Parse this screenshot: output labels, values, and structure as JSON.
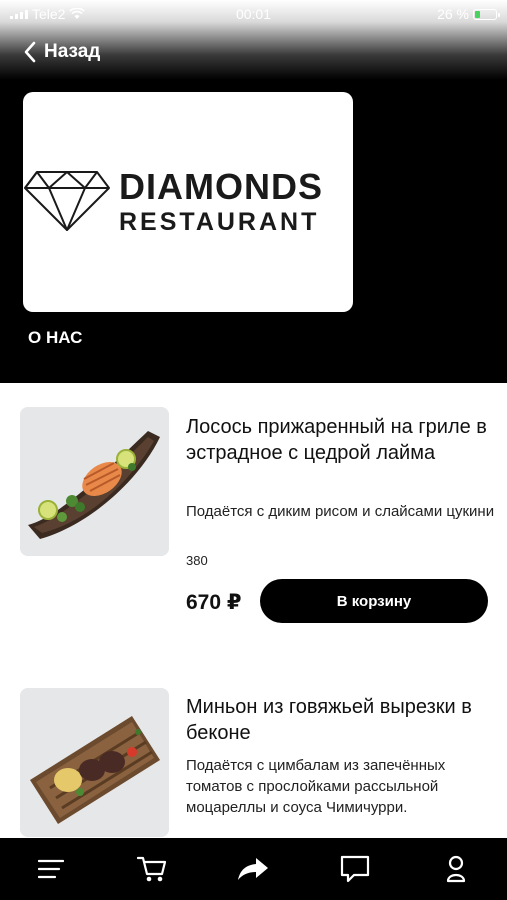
{
  "status_bar": {
    "carrier": "Tele2",
    "time": "00:01",
    "battery": "26 %",
    "battery_level": 0.26
  },
  "header": {
    "back_label": "Назад"
  },
  "restaurant": {
    "logo_line1": "DIAMONDS",
    "logo_line2": "RESTAURANT",
    "about_label": "О НАС"
  },
  "menu": {
    "items": [
      {
        "title": "Лосось прижаренный на гриле в эстрадное с цедрой лайма",
        "description": "Подаётся с диким рисом и слайсами цукини",
        "weight": "380",
        "price": "670 ₽",
        "button_label": "В корзину"
      },
      {
        "title": "Миньон из говяжьей вырезки в беконе",
        "description": "Подаётся с цимбалам из запечённых томатов с прослойками рассыльной моцареллы и соуса Чимичурри."
      }
    ]
  },
  "tab_bar": {
    "icons": [
      "menu-icon",
      "cart-icon",
      "share-icon",
      "chat-icon",
      "profile-icon"
    ]
  }
}
